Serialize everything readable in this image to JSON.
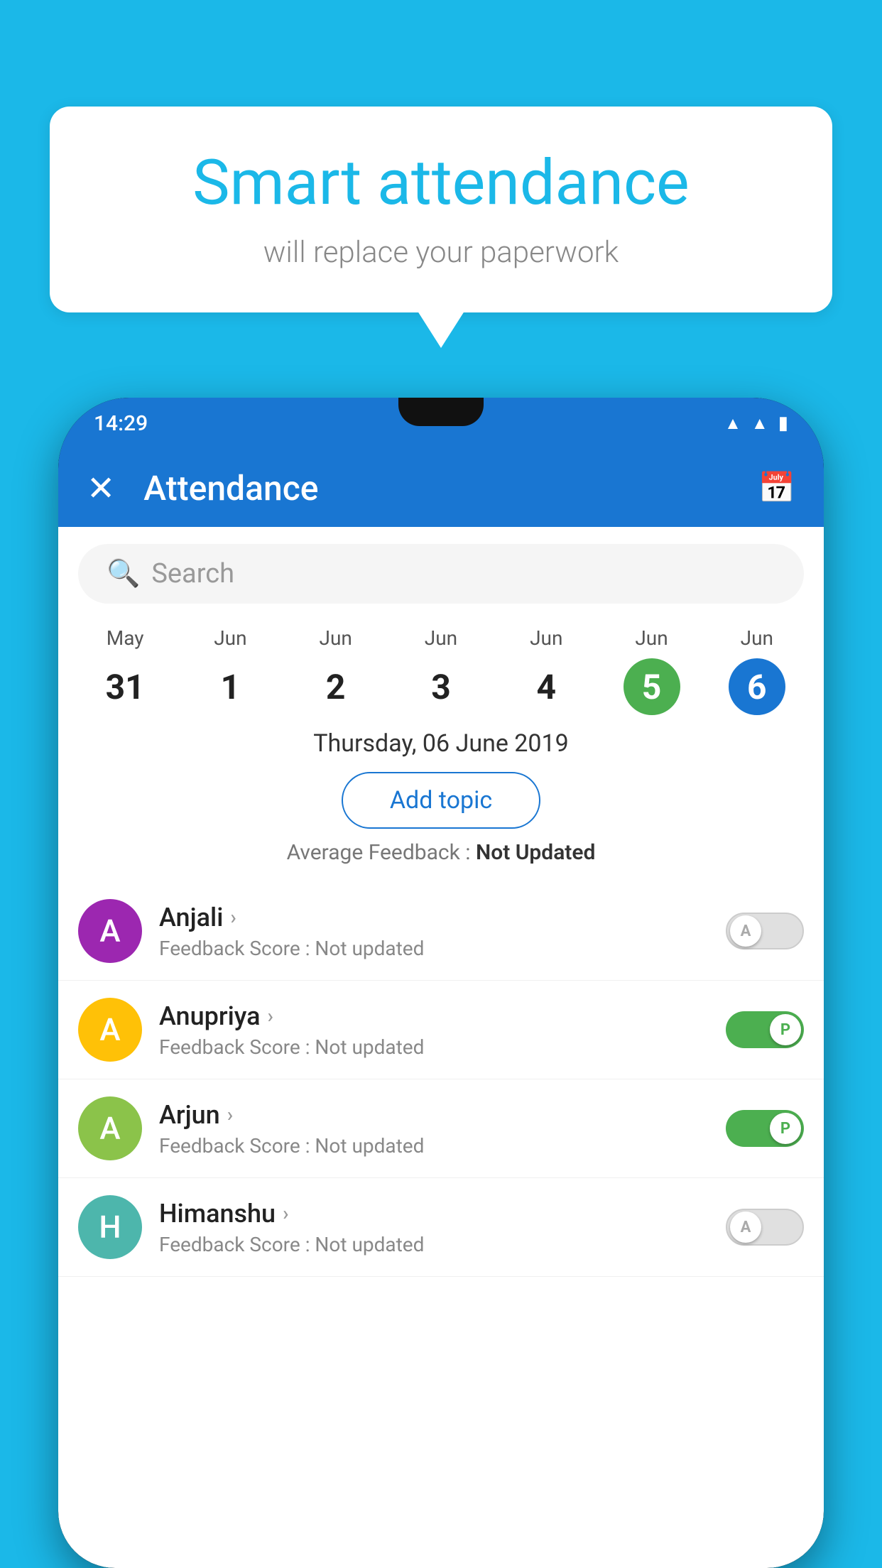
{
  "background": {
    "color": "#1BB8E8"
  },
  "speech_bubble": {
    "title": "Smart attendance",
    "subtitle": "will replace your paperwork"
  },
  "status_bar": {
    "time": "14:29",
    "wifi": "wifi",
    "signal": "signal",
    "battery": "battery"
  },
  "app_bar": {
    "close_label": "✕",
    "title": "Attendance",
    "calendar_label": "📅"
  },
  "search": {
    "placeholder": "Search"
  },
  "calendar": {
    "days": [
      {
        "month": "May",
        "date": "31",
        "state": "normal"
      },
      {
        "month": "Jun",
        "date": "1",
        "state": "normal"
      },
      {
        "month": "Jun",
        "date": "2",
        "state": "normal"
      },
      {
        "month": "Jun",
        "date": "3",
        "state": "normal"
      },
      {
        "month": "Jun",
        "date": "4",
        "state": "normal"
      },
      {
        "month": "Jun",
        "date": "5",
        "state": "today"
      },
      {
        "month": "Jun",
        "date": "6",
        "state": "selected"
      }
    ],
    "selected_date_label": "Thursday, 06 June 2019"
  },
  "add_topic_button": "Add topic",
  "average_feedback": {
    "label": "Average Feedback : ",
    "value": "Not Updated"
  },
  "students": [
    {
      "name": "Anjali",
      "avatar_letter": "A",
      "avatar_color": "purple",
      "feedback": "Feedback Score : Not updated",
      "attendance": "A",
      "present": false
    },
    {
      "name": "Anupriya",
      "avatar_letter": "A",
      "avatar_color": "yellow",
      "feedback": "Feedback Score : Not updated",
      "attendance": "P",
      "present": true
    },
    {
      "name": "Arjun",
      "avatar_letter": "A",
      "avatar_color": "green",
      "feedback": "Feedback Score : Not updated",
      "attendance": "P",
      "present": true
    },
    {
      "name": "Himanshu",
      "avatar_letter": "H",
      "avatar_color": "teal",
      "feedback": "Feedback Score : Not updated",
      "attendance": "A",
      "present": false
    }
  ]
}
